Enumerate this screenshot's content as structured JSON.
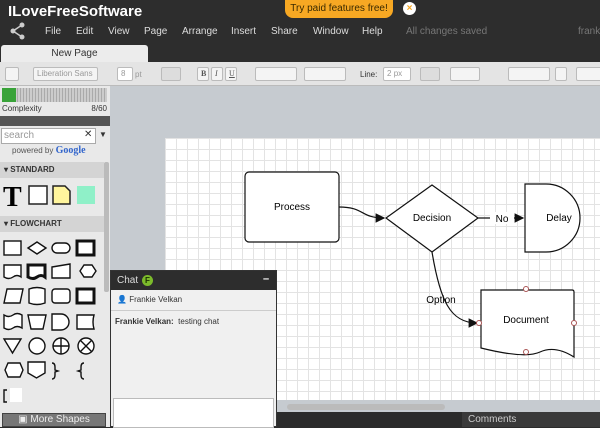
{
  "app": {
    "title": "ILoveFreeSoftware",
    "promo": "Try paid features free!",
    "status": "All changes saved",
    "user": "franki"
  },
  "menu": [
    "File",
    "Edit",
    "View",
    "Page",
    "Arrange",
    "Insert",
    "Share",
    "Window",
    "Help"
  ],
  "tab": "New Page",
  "toolbar": {
    "font": "Liberation Sans",
    "font_size": "8",
    "font_unit": "pt",
    "bold": "B",
    "italic": "I",
    "underline": "U",
    "line_label": "Line:",
    "line_width": "2",
    "line_unit": "px"
  },
  "sidebar": {
    "complexity_label": "Complexity",
    "complexity_value": "8/60",
    "complexity_fraction": 0.133,
    "search_placeholder": "search",
    "powered_by": "powered by",
    "google": "Google",
    "sections": [
      "STANDARD",
      "FLOWCHART"
    ],
    "more_shapes": "More Shapes"
  },
  "diagram": {
    "process": "Process",
    "decision": "Decision",
    "delay": "Delay",
    "document": "Document",
    "edge_no": "No",
    "edge_option": "Option"
  },
  "chat": {
    "title": "Chat",
    "badge": "F",
    "minimize": "–",
    "participant": "Frankie Velkan",
    "message_author": "Frankie Velkan:",
    "message_text": "testing chat"
  },
  "comments": "Comments",
  "colors": {
    "promo": "#f7a823",
    "complexity": "#39a339",
    "note": "#fff59d",
    "swatch": "#8ff0c8"
  }
}
